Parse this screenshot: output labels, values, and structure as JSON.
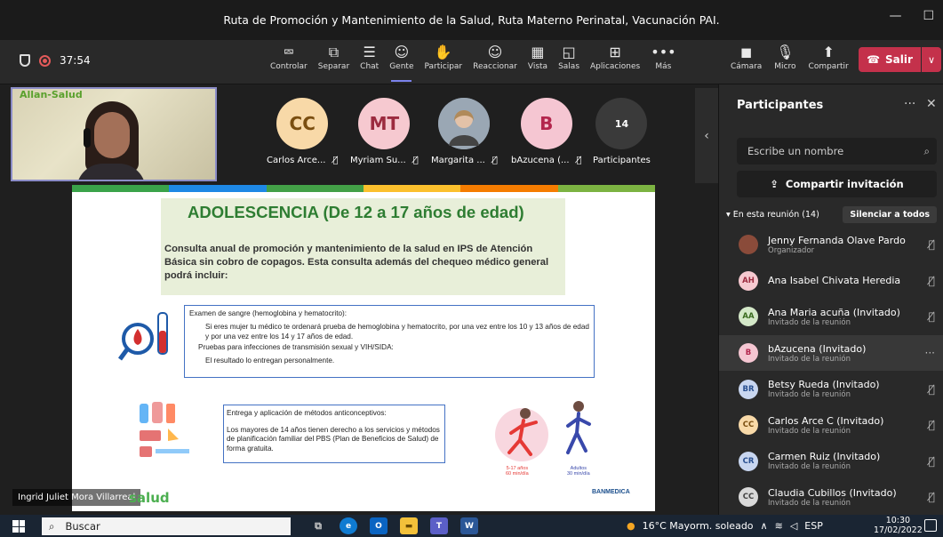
{
  "window": {
    "title": "Ruta de Promoción y Mantenimiento de la Salud, Ruta Materno Perinatal, Vacunación PAI."
  },
  "meeting": {
    "timer": "37:54"
  },
  "toolbar": {
    "items": [
      {
        "label": "Controlar",
        "icon": "⮹"
      },
      {
        "label": "Separar",
        "icon": "⧉"
      },
      {
        "label": "Chat",
        "icon": "☰"
      },
      {
        "label": "Gente",
        "icon": "☺"
      },
      {
        "label": "Participar",
        "icon": "✋"
      },
      {
        "label": "Reaccionar",
        "icon": "☺"
      },
      {
        "label": "Vista",
        "icon": "▦"
      },
      {
        "label": "Salas",
        "icon": "◱"
      },
      {
        "label": "Aplicaciones",
        "icon": "⊞"
      },
      {
        "label": "Más",
        "icon": "•••"
      }
    ],
    "device_items": [
      {
        "label": "Cámara",
        "icon": "◼"
      },
      {
        "label": "Micro",
        "icon": "🎙"
      },
      {
        "label": "Compartir",
        "icon": "⬆"
      }
    ],
    "exit_label": "Salir"
  },
  "tiles": [
    {
      "initials": "CC",
      "name": "Carlos Arce...",
      "bg": "#f8d9a8",
      "fg": "#7a4e10"
    },
    {
      "initials": "MT",
      "name": "Myriam Su...",
      "bg": "#f6c9d0",
      "fg": "#9c2b3f"
    },
    {
      "initials": "",
      "name": "Margarita ...",
      "bg": "#6c7b8a",
      "fg": "#ffffff"
    },
    {
      "initials": "B",
      "name": "bAzucena (...",
      "bg": "#f5c6d2",
      "fg": "#b3264d"
    },
    {
      "initials": "14",
      "name": "Participantes",
      "bg": "#3a3a3a",
      "fg": "#ffffff"
    }
  ],
  "self_view": {
    "logo": "Allan-Salud",
    "name": "Ingrid Juliet Mora Villarreal",
    "brand": "salud"
  },
  "slide": {
    "title": "ADOLESCENCIA (De 12 a 17 años de edad)",
    "intro": "Consulta anual de promoción y mantenimiento de la salud en IPS de Atención Básica sin cobro de copagos. Esta consulta además del chequeo médico general podrá incluir:",
    "box1_title": "Examen de sangre (hemoglobina y hematocrito):",
    "box1_line1": "Si eres mujer tu médico te ordenará prueba de hemoglobina y hematocrito, por una vez entre los 10 y 13 años de edad y por una vez entre los 14 y 17 años de edad.",
    "box1_line2": "Pruebas para infecciones de transmisión sexual y VIH/SIDA:",
    "box1_line3": "El resultado lo entregan personalmente.",
    "box2_title": "Entrega y aplicación de métodos anticonceptivos:",
    "box2_body": "Los mayores de 14 años tienen derecho a los servicios y métodos de planificación familiar del PBS (Plan de Beneficios de Salud) de forma gratuita.",
    "age_label_1": "5-17 años",
    "age_sub_1": "60 min/día",
    "age_label_2": "Adultos",
    "age_sub_2": "30 min/día",
    "brand": "BANMEDICA"
  },
  "panel": {
    "title": "Participantes",
    "search_placeholder": "Escribe un nombre",
    "share_label": "Compartir invitación",
    "section_label": "En esta reunión (14)",
    "mute_all": "Silenciar a todos",
    "participants": [
      {
        "initials": "",
        "name": "Jenny Fernanda Olave Pardo",
        "role": "Organizador",
        "bg": "#8a4b3a",
        "fg": "#ffffff",
        "action": "mic-off"
      },
      {
        "initials": "AH",
        "name": "Ana Isabel Chivata Heredia",
        "role": "",
        "bg": "#f6c9d0",
        "fg": "#9c2b3f",
        "action": "mic-off"
      },
      {
        "initials": "AA",
        "name": "Ana Maria acuña (Invitado)",
        "role": "Invitado de la reunión",
        "bg": "#d4e8c8",
        "fg": "#3a6b1f",
        "action": "mic-off"
      },
      {
        "initials": "B",
        "name": "bAzucena (Invitado)",
        "role": "Invitado de la reunión",
        "bg": "#f5c6d2",
        "fg": "#b3264d",
        "action": "more"
      },
      {
        "initials": "BR",
        "name": "Betsy Rueda (Invitado)",
        "role": "Invitado de la reunión",
        "bg": "#c8d6f0",
        "fg": "#274e8f",
        "action": "mic-off"
      },
      {
        "initials": "CC",
        "name": "Carlos Arce C (Invitado)",
        "role": "Invitado de la reunión",
        "bg": "#f8d9a8",
        "fg": "#7a4e10",
        "action": "mic-off"
      },
      {
        "initials": "CR",
        "name": "Carmen Ruiz (Invitado)",
        "role": "Invitado de la reunión",
        "bg": "#c8d6f0",
        "fg": "#274e8f",
        "action": "mic-off"
      },
      {
        "initials": "CC",
        "name": "Claudia Cubillos (Invitado)",
        "role": "Invitado de la reunión",
        "bg": "#d9d9d9",
        "fg": "#444444",
        "action": "mic-off"
      }
    ]
  },
  "taskbar": {
    "search_label": "Buscar",
    "weather": "16°C  Mayorm. soleado",
    "lang": "ESP",
    "time": "10:30",
    "date": "17/02/2022"
  }
}
